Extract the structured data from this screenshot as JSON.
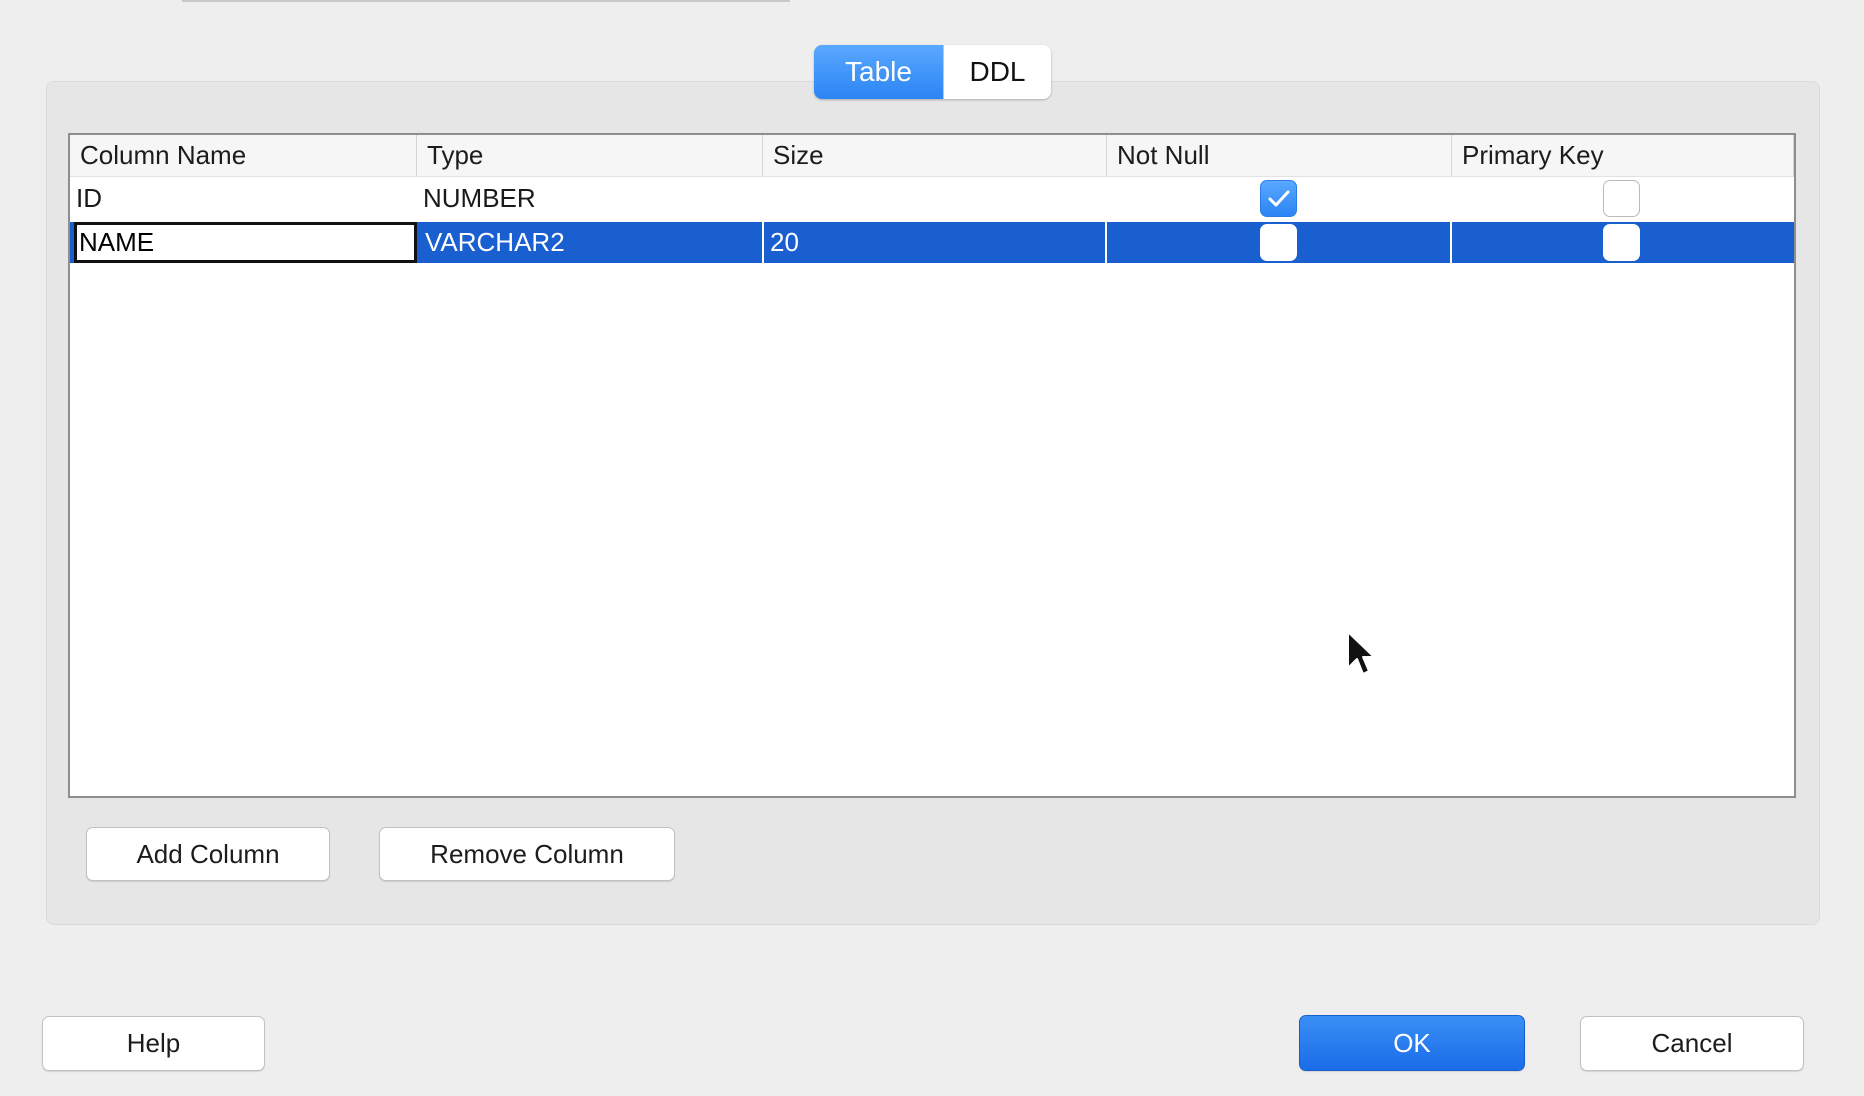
{
  "tabs": [
    {
      "label": "Table",
      "active": true
    },
    {
      "label": "DDL",
      "active": false
    }
  ],
  "table": {
    "headers": [
      "Column Name",
      "Type",
      "Size",
      "Not Null",
      "Primary Key"
    ],
    "rows": [
      {
        "column_name": "ID",
        "type": "NUMBER",
        "size": "",
        "not_null": true,
        "primary_key": false,
        "selected": false
      },
      {
        "column_name": "NAME",
        "type": "VARCHAR2",
        "size": "20",
        "not_null": false,
        "primary_key": false,
        "selected": true
      }
    ]
  },
  "buttons": {
    "add_column": "Add Column",
    "remove_column": "Remove Column",
    "help": "Help",
    "ok": "OK",
    "cancel": "Cancel"
  },
  "colors": {
    "accent": "#2b85f4",
    "selection": "#1a5fcf",
    "background": "#eeeeee"
  }
}
